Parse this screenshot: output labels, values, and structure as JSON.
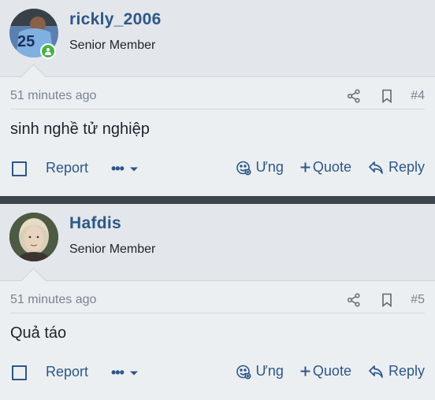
{
  "posts": [
    {
      "username": "rickly_2006",
      "user_title": "Senior Member",
      "time": "51 minutes ago",
      "post_number": "#4",
      "content": "sinh nghề tử nghiệp",
      "report_label": "Report",
      "react_label": "Ưng",
      "quote_label": "Quote",
      "reply_label": "Reply",
      "more_label": "•••",
      "online": true,
      "avatar_jersey_number": "25"
    },
    {
      "username": "Hafdis",
      "user_title": "Senior Member",
      "time": "51 minutes ago",
      "post_number": "#5",
      "content": "Quả táo",
      "report_label": "Report",
      "react_label": "Ưng",
      "quote_label": "Quote",
      "reply_label": "Reply",
      "more_label": "•••",
      "online": false
    }
  ],
  "colors": {
    "accent": "#2c5788",
    "online": "#49b248",
    "divider": "#3e444b",
    "muted": "#7a8390"
  },
  "icons": {
    "share": "share-icon",
    "bookmark": "bookmark-icon",
    "react": "smiley-react-icon",
    "quote": "plus-icon",
    "reply": "reply-arrow-icon",
    "more_caret": "caret-down-icon"
  }
}
